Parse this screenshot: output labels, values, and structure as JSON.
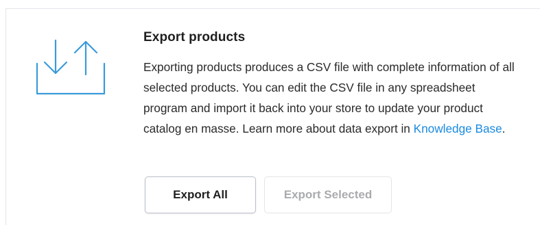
{
  "export": {
    "title": "Export products",
    "description_text": "Exporting products produces a CSV file with complete information of all selected products. You can edit the CSV file in any spreadsheet program and import it back into your store to update your product catalog en masse. Learn more about data export in ",
    "link_text": "Knowledge Base",
    "description_end": ".",
    "icon": "export-import-arrows-icon"
  },
  "buttons": {
    "export_all_label": "Export All",
    "export_selected_label": "Export Selected"
  },
  "colors": {
    "icon_stroke": "#3a9ad9",
    "link": "#1a8ae0",
    "disabled_text": "#a9abae"
  }
}
